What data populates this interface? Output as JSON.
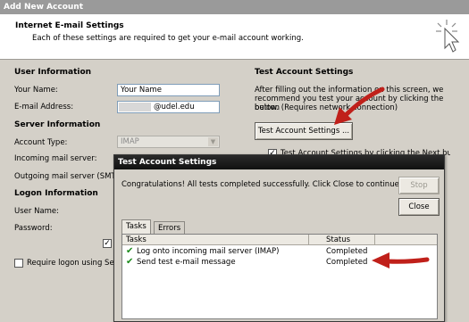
{
  "window": {
    "title": "Add New Account"
  },
  "header": {
    "title": "Internet E-mail Settings",
    "subtitle": "Each of these settings are required to get your e-mail account working."
  },
  "user_info": {
    "heading": "User Information",
    "name_label": "Your Name:",
    "name_value": "Your Name",
    "email_label": "E-mail Address:",
    "email_value": "@udel.edu"
  },
  "server_info": {
    "heading": "Server Information",
    "account_type_label": "Account Type:",
    "account_type_value": "IMAP",
    "incoming_label": "Incoming mail server:",
    "outgoing_label": "Outgoing mail server (SMTP):"
  },
  "logon_info": {
    "heading": "Logon Information",
    "username_label": "User Name:",
    "password_label": "Password:",
    "spa_label": "Require logon using Secure"
  },
  "test_settings": {
    "heading": "Test Account Settings",
    "description_lines": [
      "After filling out the information on this screen, we",
      "recommend you test your account by clicking the button",
      "below. (Requires network connection)"
    ],
    "button_label": "Test Account Settings ...",
    "checkbox_label": "Test Account Settings by clicking the Next button"
  },
  "dialog": {
    "title": "Test Account Settings",
    "message": "Congratulations! All tests completed successfully. Click Close to continue.",
    "stop_label": "Stop",
    "close_label": "Close",
    "tabs": [
      {
        "label": "Tasks"
      },
      {
        "label": "Errors"
      }
    ],
    "columns": {
      "tasks": "Tasks",
      "status": "Status"
    },
    "rows": [
      {
        "task": "Log onto incoming mail server (IMAP)",
        "status": "Completed"
      },
      {
        "task": "Send test e-mail message",
        "status": "Completed"
      }
    ]
  },
  "colors": {
    "arrow": "#c0201a",
    "check": "#1a8a1a"
  },
  "icons": {
    "header_icon": "cursor-click-icon"
  }
}
